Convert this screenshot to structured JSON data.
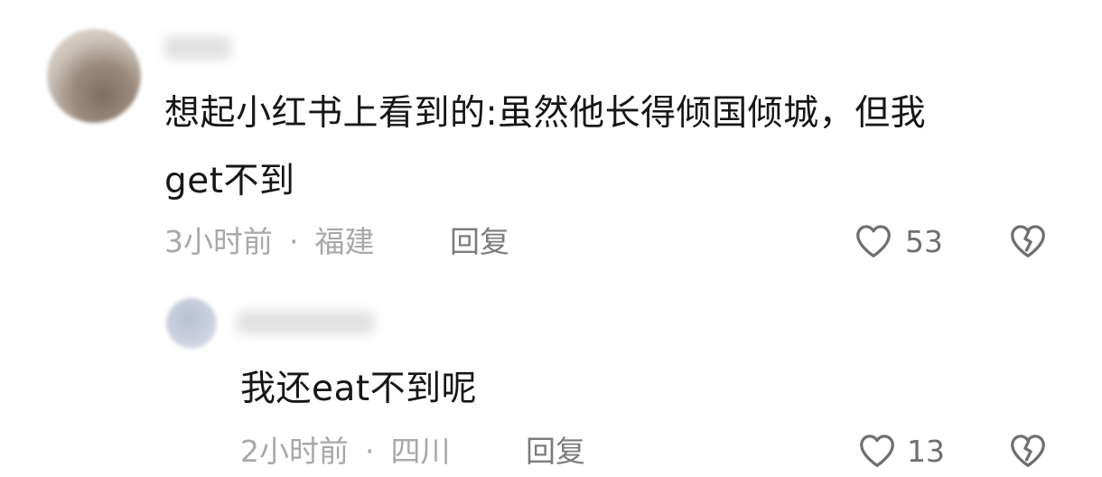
{
  "comments": [
    {
      "username": "",
      "text_line1": "想起小红书上看到的:虽然他长得倾国倾城，但我",
      "text_line2": "get不到",
      "time": "3小时前",
      "separator": "·",
      "location": "福建",
      "reply_label": "回复",
      "like_count": "53",
      "like_icon": "heart-outline-icon",
      "dislike_icon": "broken-heart-icon"
    },
    {
      "username": "",
      "text": "我还eat不到呢",
      "time": "2小时前",
      "separator": "·",
      "location": "四川",
      "reply_label": "回复",
      "like_count": "13",
      "like_icon": "heart-outline-icon",
      "dislike_icon": "broken-heart-icon"
    }
  ],
  "colors": {
    "text": "#161616",
    "meta": "#a8a8a8",
    "reply": "#7c7c7c",
    "icon": "#6f6f6f"
  }
}
